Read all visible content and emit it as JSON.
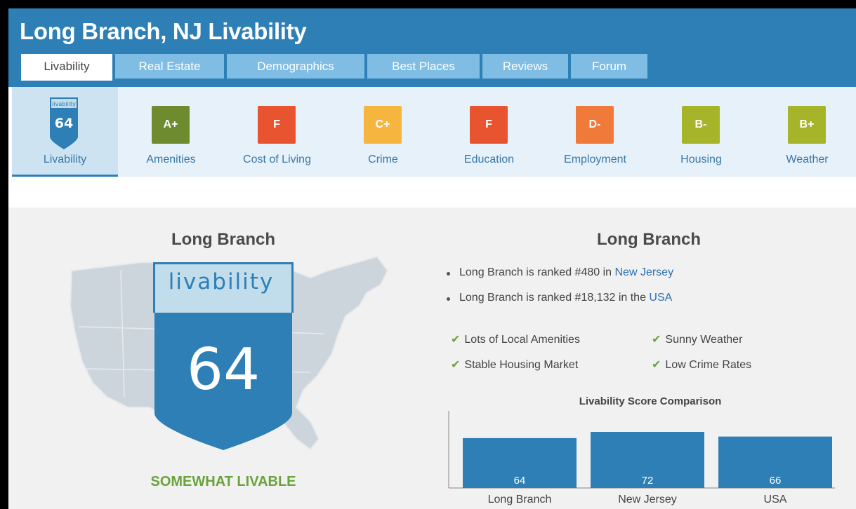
{
  "header": {
    "title": "Long Branch, NJ Livability",
    "tabs": [
      "Livability",
      "Real Estate",
      "Demographics",
      "Best Places",
      "Reviews",
      "Forum"
    ]
  },
  "categories": [
    {
      "label": "Livability",
      "badge_word": "livability",
      "score": "64",
      "active": true
    },
    {
      "label": "Amenities",
      "grade": "A+",
      "color": "#6f8b2f"
    },
    {
      "label": "Cost of Living",
      "grade": "F",
      "color": "#e8542f"
    },
    {
      "label": "Crime",
      "grade": "C+",
      "color": "#f6b53e"
    },
    {
      "label": "Education",
      "grade": "F",
      "color": "#e8542f"
    },
    {
      "label": "Employment",
      "grade": "D-",
      "color": "#ef7a3a"
    },
    {
      "label": "Housing",
      "grade": "B-",
      "color": "#a6b42a"
    },
    {
      "label": "Weather",
      "grade": "B+",
      "color": "#a6b42a"
    }
  ],
  "left_panel": {
    "heading": "Long Branch",
    "badge_word": "livability",
    "score": "64",
    "verdict": "SOMEWHAT LIVABLE"
  },
  "right_panel": {
    "heading": "Long Branch",
    "rank_state": {
      "text": "Long Branch is ranked #480 in ",
      "link": "New Jersey"
    },
    "rank_country": {
      "text": "Long Branch is ranked #18,132 in the ",
      "link": "USA"
    },
    "highlights": [
      "Lots of Local Amenities",
      "Sunny Weather",
      "Stable Housing Market",
      "Low Crime Rates"
    ]
  },
  "chart_data": {
    "type": "bar",
    "title": "Livability Score Comparison",
    "categories": [
      "Long Branch",
      "New Jersey",
      "USA"
    ],
    "values": [
      64,
      72,
      66
    ],
    "color": "#2d7fb5"
  }
}
